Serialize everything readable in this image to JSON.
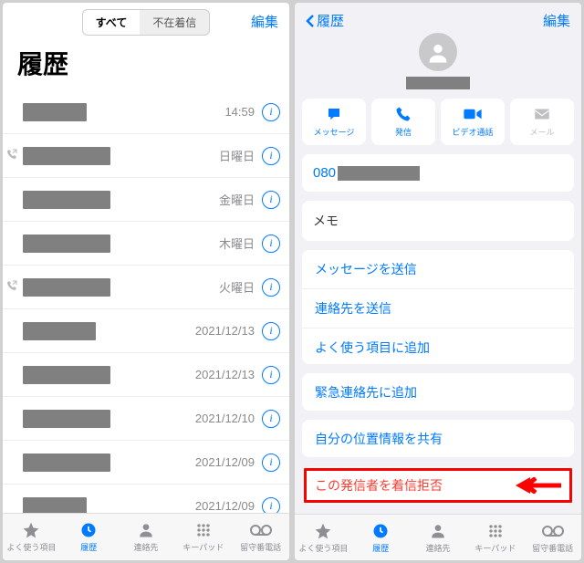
{
  "left": {
    "seg_all": "すべて",
    "seg_missed": "不在着信",
    "edit": "編集",
    "title": "履歴",
    "rows": [
      {
        "outgoing": false,
        "width": 70,
        "date": "14:59"
      },
      {
        "outgoing": true,
        "width": 96,
        "date": "日曜日"
      },
      {
        "outgoing": false,
        "width": 96,
        "date": "金曜日"
      },
      {
        "outgoing": false,
        "width": 96,
        "date": "木曜日"
      },
      {
        "outgoing": true,
        "width": 96,
        "date": "火曜日"
      },
      {
        "outgoing": false,
        "width": 80,
        "date": "2021/12/13"
      },
      {
        "outgoing": false,
        "width": 96,
        "date": "2021/12/13"
      },
      {
        "outgoing": false,
        "width": 96,
        "date": "2021/12/10"
      },
      {
        "outgoing": false,
        "width": 96,
        "date": "2021/12/09"
      },
      {
        "outgoing": false,
        "width": 70,
        "date": "2021/12/09"
      }
    ]
  },
  "right": {
    "back": "履歴",
    "edit": "編集",
    "actions": {
      "message": "メッセージ",
      "call": "発信",
      "video": "ビデオ通話",
      "mail": "メール"
    },
    "phone_prefix": "080",
    "memo": "メモ",
    "links": {
      "send_message": "メッセージを送信",
      "send_contact": "連絡先を送信",
      "add_favorite": "よく使う項目に追加",
      "add_emergency": "緊急連絡先に追加",
      "share_location": "自分の位置情報を共有",
      "block": "この発信者を着信拒否"
    }
  },
  "tabs": {
    "favorites": "よく使う項目",
    "history": "履歴",
    "contacts": "連絡先",
    "keypad": "キーパッド",
    "voicemail": "留守番電話"
  }
}
